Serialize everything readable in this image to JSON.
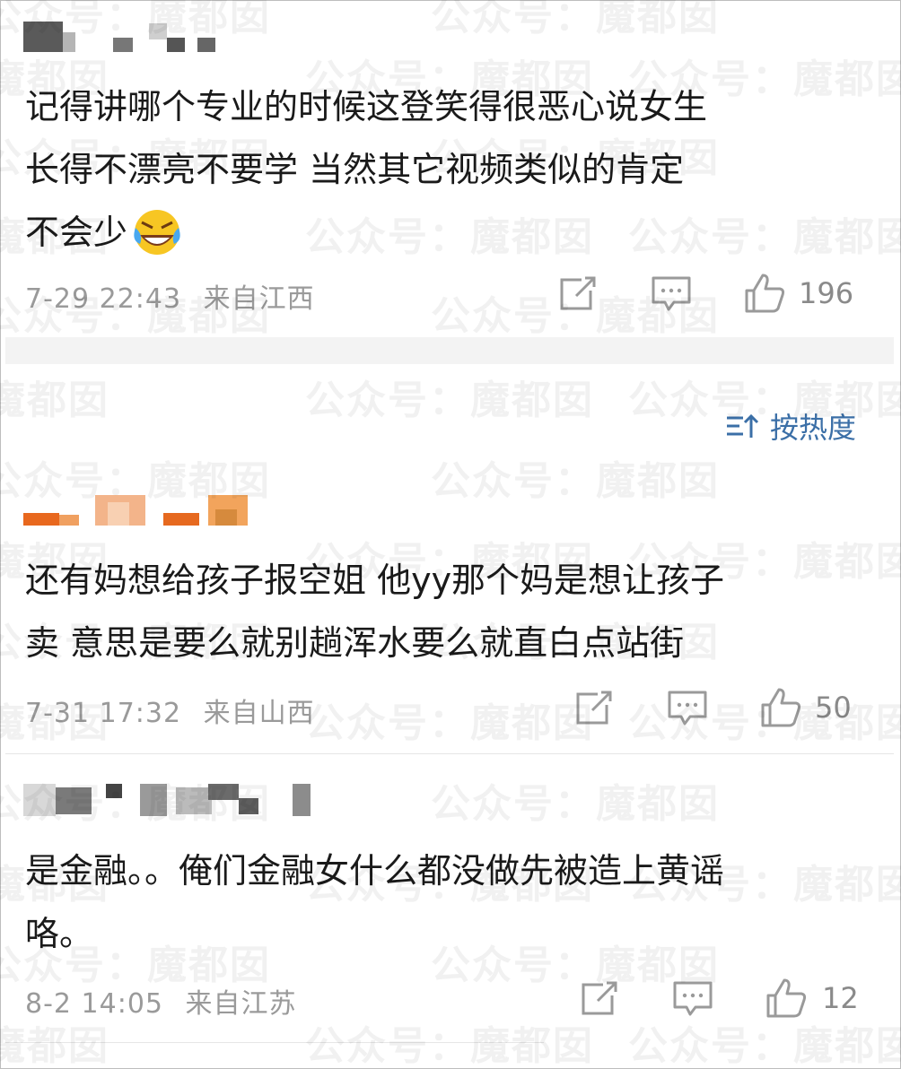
{
  "watermark": {
    "text": "公众号：魔都囡"
  },
  "sort": {
    "label": "按热度",
    "icon": "sort-icon"
  },
  "comments": [
    {
      "text_lines": [
        "记得讲哪个专业的时候这登笑得很恶心说女生",
        "长得不漂亮不要学  当然其它视频类似的肯定",
        "不会少"
      ],
      "emoji": "laughing-crying-emoji",
      "date": "7-29 22:43",
      "location": "来自江西",
      "likes": "196"
    },
    {
      "text_lines": [
        "还有妈想给孩子报空姐 他yy那个妈是想让孩子",
        "卖 意思是要么就别趟浑水要么就直白点站街"
      ],
      "date": "7-31 17:32",
      "location": "来自山西",
      "likes": "50"
    },
    {
      "text_lines": [
        "是金融。。俺们金融女什么都没做先被造上黄谣",
        "咯。"
      ],
      "date": "8-2 14:05",
      "location": "来自江苏",
      "likes": "12"
    }
  ],
  "icons": [
    "share-icon",
    "comment-icon",
    "like-icon"
  ],
  "colors": {
    "accent": "#3b6fa7",
    "meta": "#9a9a9a",
    "band": "#f3f3f3"
  }
}
